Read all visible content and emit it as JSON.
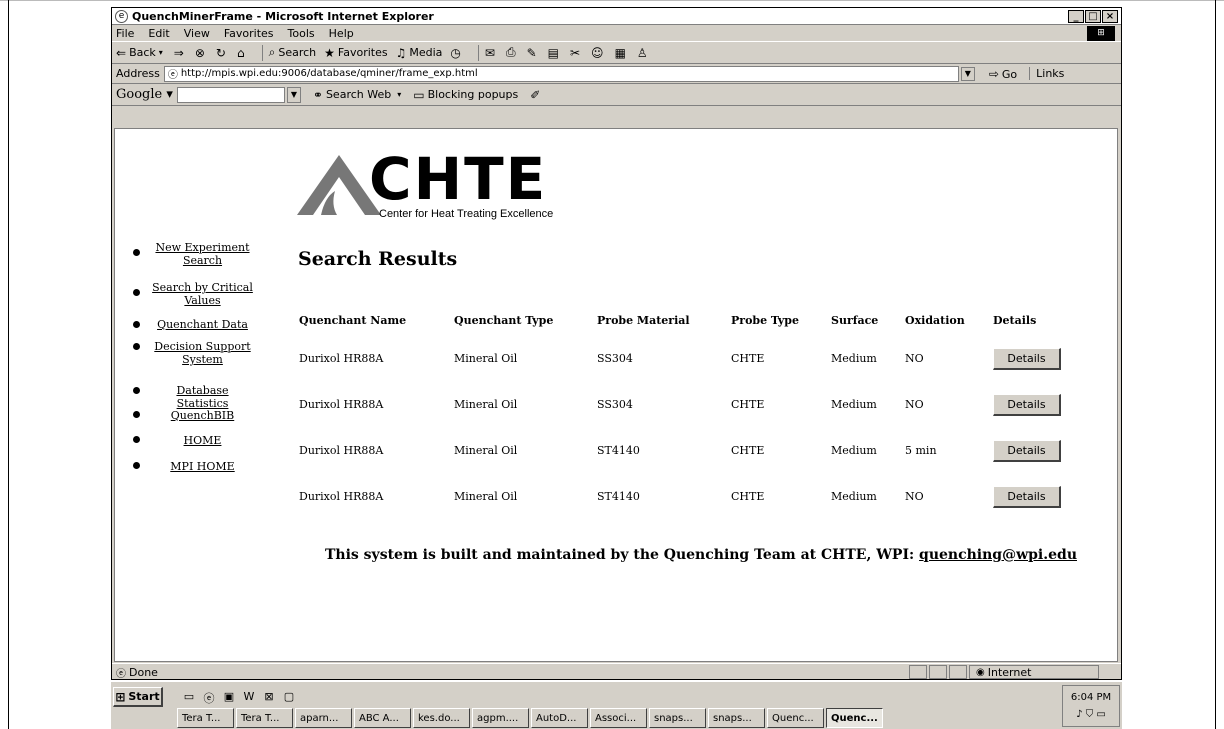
{
  "window": {
    "title": "QuenchMinerFrame - Microsoft Internet Explorer",
    "min_label": "_",
    "max_label": "□",
    "close_label": "×"
  },
  "menu": [
    "File",
    "Edit",
    "View",
    "Favorites",
    "Tools",
    "Help"
  ],
  "toolbar": {
    "back": "Back",
    "search": "Search",
    "favorites": "Favorites",
    "media": "Media"
  },
  "address": {
    "label": "Address",
    "url": "http://mpis.wpi.edu:9006/database/qminer/frame_exp.html",
    "go": "Go",
    "links": "Links"
  },
  "googlebar": {
    "logo": "Google",
    "search_web": "Search Web",
    "blocking": "Blocking popups"
  },
  "logo": {
    "brand": "CHTE",
    "subtitle": "Center for Heat Treating Excellence"
  },
  "nav": [
    {
      "label": "New Experiment Search"
    },
    {
      "label": "Search by Critical Values"
    },
    {
      "label": "Quenchant Data"
    },
    {
      "label": "Decision Support System"
    },
    {
      "label": "Database Statistics"
    },
    {
      "label": "QuenchBIB"
    },
    {
      "label": "HOME"
    },
    {
      "label": "MPI HOME"
    }
  ],
  "results": {
    "title": "Search Results",
    "headers": {
      "name": "Quenchant Name",
      "type": "Quenchant Type",
      "material": "Probe Material",
      "probe": "Probe Type",
      "surface": "Surface",
      "oxidation": "Oxidation",
      "details": "Details"
    },
    "rows": [
      {
        "name": "Durixol HR88A",
        "type": "Mineral Oil",
        "material": "SS304",
        "probe": "CHTE",
        "surface": "Medium",
        "oxidation": "NO",
        "button": "Details"
      },
      {
        "name": "Durixol HR88A",
        "type": "Mineral Oil",
        "material": "SS304",
        "probe": "CHTE",
        "surface": "Medium",
        "oxidation": "NO",
        "button": "Details"
      },
      {
        "name": "Durixol HR88A",
        "type": "Mineral Oil",
        "material": "ST4140",
        "probe": "CHTE",
        "surface": "Medium",
        "oxidation": "5 min",
        "button": "Details"
      },
      {
        "name": "Durixol HR88A",
        "type": "Mineral Oil",
        "material": "ST4140",
        "probe": "CHTE",
        "surface": "Medium",
        "oxidation": "NO",
        "button": "Details"
      }
    ]
  },
  "footer": {
    "text": "This system is built and maintained by the Quenching Team at CHTE, WPI: ",
    "email": "quenching@wpi.edu"
  },
  "status": {
    "text": "Done",
    "zone": "Internet"
  },
  "taskbar": {
    "start": "Start",
    "tasks": [
      "Tera T...",
      "Tera T...",
      "aparn...",
      "ABC A...",
      "kes.do...",
      "agpm....",
      "AutoD...",
      "Associ...",
      "snaps...",
      "snaps...",
      "Quenc...",
      "Quenc..."
    ],
    "clock": "6:04 PM"
  }
}
